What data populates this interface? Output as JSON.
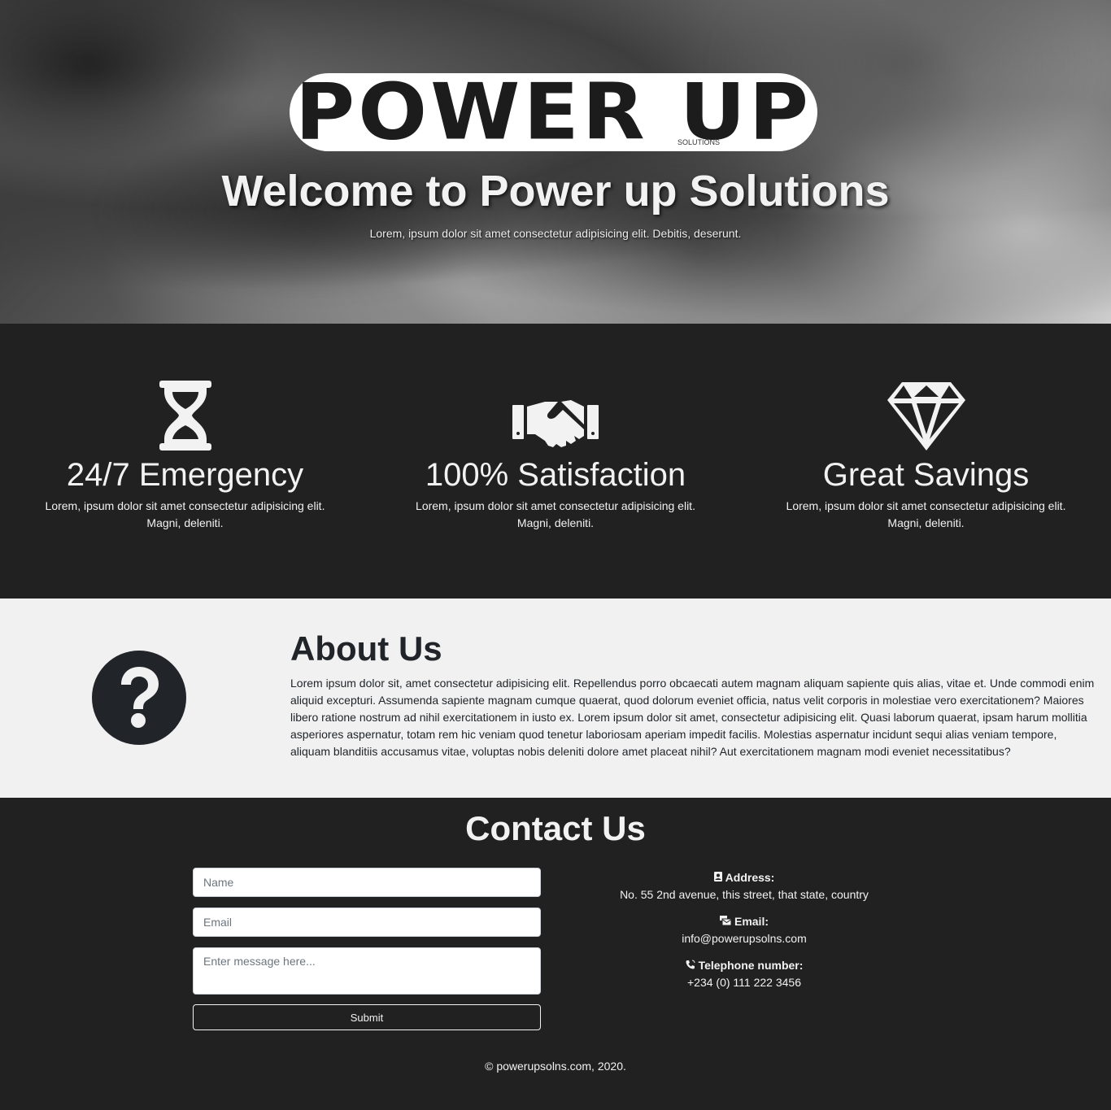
{
  "hero": {
    "logo_text": "POWER UP",
    "logo_sub": "SOLUTIONS",
    "title": "Welcome to Power up Solutions",
    "subtitle": "Lorem, ipsum dolor sit amet consectetur adipisicing elit. Debitis, deserunt."
  },
  "features": [
    {
      "icon": "hourglass-icon",
      "title": "24/7 Emergency",
      "text": "Lorem, ipsum dolor sit amet consectetur adipisicing elit. Magni, deleniti."
    },
    {
      "icon": "handshake-icon",
      "title": "100% Satisfaction",
      "text": "Lorem, ipsum dolor sit amet consectetur adipisicing elit. Magni, deleniti."
    },
    {
      "icon": "diamond-icon",
      "title": "Great Savings",
      "text": "Lorem, ipsum dolor sit amet consectetur adipisicing elit. Magni, deleniti."
    }
  ],
  "about": {
    "icon": "question-circle-icon",
    "title": "About Us",
    "text": "Lorem ipsum dolor sit, amet consectetur adipisicing elit. Repellendus porro obcaecati autem magnam aliquam sapiente quis alias, vitae et. Unde commodi enim aliquid excepturi. Assumenda sapiente magnam cumque quaerat, quod dolorum eveniet officia, natus velit corporis in molestiae vero exercitationem? Maiores libero ratione nostrum ad nihil exercitationem in iusto ex. Lorem ipsum dolor sit amet, consectetur adipisicing elit. Quasi laborum quaerat, ipsam harum mollitia asperiores aspernatur, totam rem hic veniam quod tenetur laboriosam aperiam impedit facilis. Molestias aspernatur incidunt sequi alias veniam tempore, aliquam blanditiis accusamus vitae, voluptas nobis deleniti dolore amet placeat nihil? Aut exercitationem magnam modi eveniet necessitatibus?"
  },
  "contact": {
    "title": "Contact Us",
    "form": {
      "name_placeholder": "Name",
      "email_placeholder": "Email",
      "message_placeholder": "Enter message here...",
      "submit_label": "Submit"
    },
    "info": {
      "address_label": "Address:",
      "address_value": "No. 55 2nd avenue, this street, that state, country",
      "email_label": "Email:",
      "email_value": "info@powerupsolns.com",
      "phone_label": "Telephone number:",
      "phone_value": "+234 (0) 111 222 3456"
    },
    "copyright": "© powerupsolns.com, 2020."
  }
}
